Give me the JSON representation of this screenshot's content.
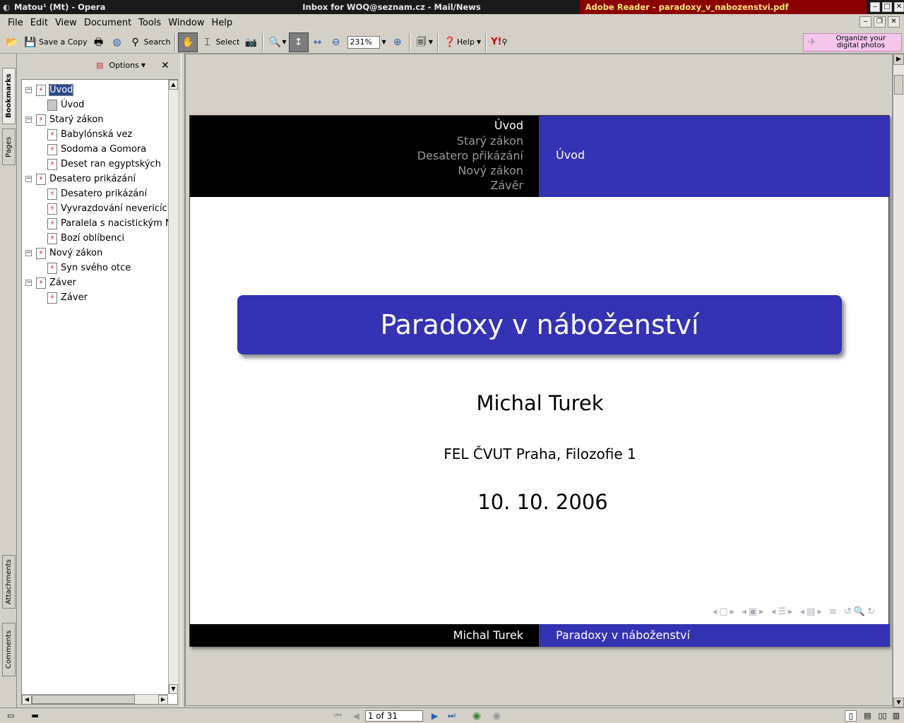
{
  "titlebar": {
    "window_opera": "Matou¹ (Mt) - Opera",
    "window_mail": "Inbox for WOQ@seznam.cz - Mail/News",
    "window_reader": "Adobe Reader - paradoxy_v_nabozenstvi.pdf",
    "colors": {
      "active_bg": "#8b0000",
      "active_fg": "#ffe87a"
    }
  },
  "menubar": {
    "items": [
      "File",
      "Edit",
      "View",
      "Document",
      "Tools",
      "Window",
      "Help"
    ]
  },
  "toolbar": {
    "save_copy": "Save a Copy",
    "search": "Search",
    "select": "Select",
    "zoom": "231%",
    "help": "Help",
    "promo_line1": "Organize your",
    "promo_line2": "digital photos"
  },
  "side_tabs": {
    "bookmarks": "Bookmarks",
    "pages": "Pages",
    "attachments": "Attachments",
    "comments": "Comments"
  },
  "navpanel": {
    "options": "Options",
    "items": [
      {
        "label": "Úvod",
        "level": 0,
        "selected": true
      },
      {
        "label": "Úvod",
        "level": 1,
        "page_icon": true
      },
      {
        "label": "Starý zákon",
        "level": 0
      },
      {
        "label": "Babylónská vez",
        "level": 1
      },
      {
        "label": "Sodoma a Gomora",
        "level": 1
      },
      {
        "label": "Deset ran egyptských",
        "level": 1
      },
      {
        "label": "Desatero prikázání",
        "level": 0
      },
      {
        "label": "Desatero prikázání",
        "level": 1
      },
      {
        "label": "Vyvrazdování nevericích",
        "level": 1
      },
      {
        "label": "Paralela s nacistickým N",
        "level": 1
      },
      {
        "label": "Bozí oblíbenci",
        "level": 1
      },
      {
        "label": "Nový zákon",
        "level": 0
      },
      {
        "label": "Syn svého otce",
        "level": 1
      },
      {
        "label": "Záver",
        "level": 0
      },
      {
        "label": "Záver",
        "level": 1
      }
    ]
  },
  "slide": {
    "sections": [
      "Úvod",
      "Starý zákon",
      "Desatero přikázání",
      "Nový zákon",
      "Závěr"
    ],
    "current_section": "Úvod",
    "title": "Paradoxy v náboženství",
    "author": "Michal Turek",
    "institute": "FEL ČVUT Praha, Filozofie 1",
    "date": "10. 10. 2006",
    "footer_author": "Michal Turek",
    "footer_title": "Paradoxy v náboženství",
    "colors": {
      "beamer_blue": "#3333b3",
      "black": "#000000"
    }
  },
  "statusbar": {
    "page": "1 of 31"
  }
}
